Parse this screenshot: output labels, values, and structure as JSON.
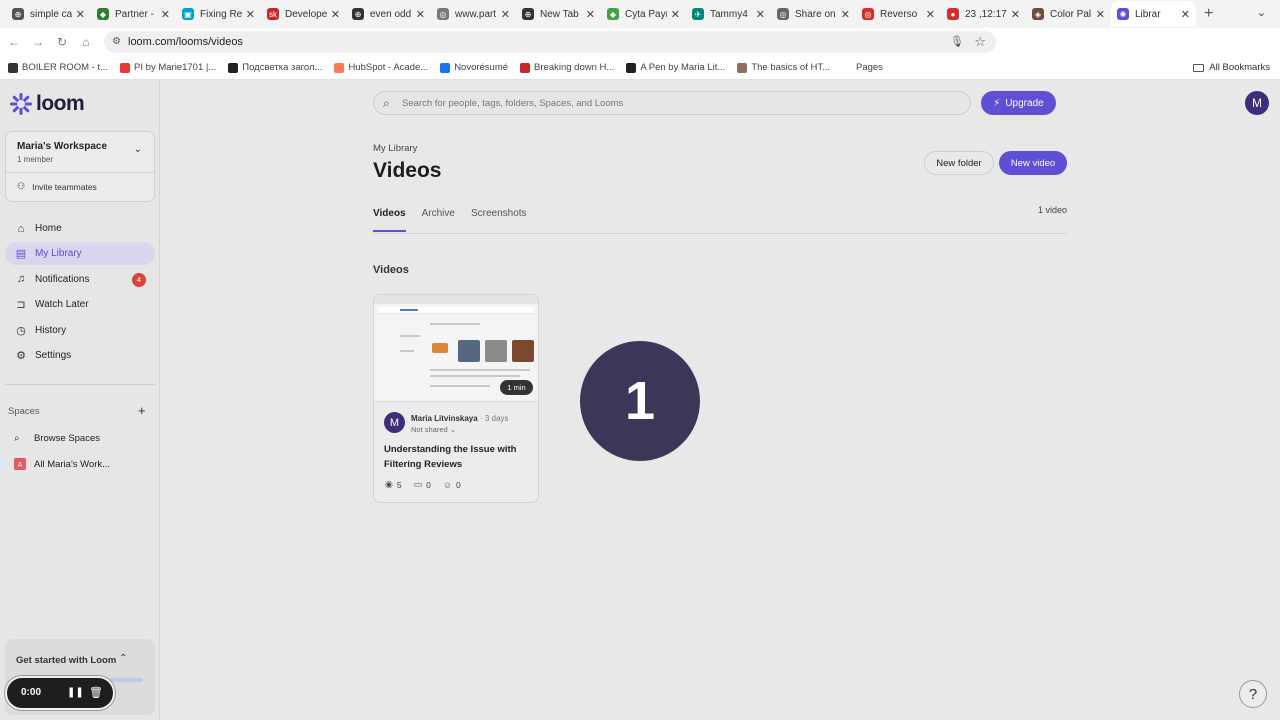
{
  "browser": {
    "tabs": [
      {
        "title": "simple ca",
        "color": "#555555",
        "glyph": "⊕"
      },
      {
        "title": "Partner -",
        "color": "#2e7d32",
        "glyph": "◆"
      },
      {
        "title": "Fixing Re",
        "color": "#00a3c4",
        "glyph": "▣"
      },
      {
        "title": "Develope",
        "color": "#c62828",
        "glyph": "sk"
      },
      {
        "title": "even odd",
        "color": "#333333",
        "glyph": "⊕"
      },
      {
        "title": "www.part",
        "color": "#777777",
        "glyph": "◎"
      },
      {
        "title": "New Tab",
        "color": "#333333",
        "glyph": "⊕"
      },
      {
        "title": "Cyta Payr",
        "color": "#43a047",
        "glyph": "◆"
      },
      {
        "title": "Tammy4",
        "color": "#00897b",
        "glyph": "✈"
      },
      {
        "title": "Share on",
        "color": "#666666",
        "glyph": "◎"
      },
      {
        "title": "Reverso",
        "color": "#d32f2f",
        "glyph": "◎"
      },
      {
        "title": "23 ,12:17]",
        "color": "#d32f2f",
        "glyph": "●"
      },
      {
        "title": "Color Pal",
        "color": "#6d4c41",
        "glyph": "◈"
      },
      {
        "title": "Librar",
        "color": "#5e4fd4",
        "glyph": "✺",
        "active": true
      }
    ],
    "new_tab": "+",
    "url": "loom.com/looms/videos",
    "bookmarks": [
      {
        "label": "BOILER ROOM - t...",
        "color": "#333333"
      },
      {
        "label": "PI by Marie1701 |...",
        "color": "#e53935"
      },
      {
        "label": "Подсветка загол...",
        "color": "#222222"
      },
      {
        "label": "HubSpot - Acade...",
        "color": "#ff7a59"
      },
      {
        "label": "Novorésumé",
        "color": "#1a73e8"
      },
      {
        "label": "Breaking down H...",
        "color": "#c62828"
      },
      {
        "label": "A Pen by Maria Lit...",
        "color": "#222222"
      },
      {
        "label": "The basics of HT...",
        "color": "#8d6e63"
      },
      {
        "label": "Pages",
        "color": "#ffffff"
      }
    ],
    "all_bookmarks": "All Bookmarks"
  },
  "sidebar": {
    "logo": "loom",
    "workspace": {
      "name": "Maria's Workspace",
      "members": "1 member",
      "invite": "Invite teammates"
    },
    "nav": [
      {
        "label": "Home",
        "icon": "home-icon",
        "glyph": "⌂"
      },
      {
        "label": "My Library",
        "icon": "library-icon",
        "glyph": "▤",
        "active": true
      },
      {
        "label": "Notifications",
        "icon": "bell-icon",
        "glyph": "♫",
        "badge": "4"
      },
      {
        "label": "Watch Later",
        "icon": "bookmark-icon",
        "glyph": "⊐"
      },
      {
        "label": "History",
        "icon": "clock-icon",
        "glyph": "◷"
      },
      {
        "label": "Settings",
        "icon": "gear-icon",
        "glyph": "⚙"
      }
    ],
    "spaces_heading": "Spaces",
    "browse_spaces": "Browse Spaces",
    "all_workspace": "All Maria's Work...",
    "all_workspace_initial": "A",
    "get_started": "Get started with Loom",
    "recorder": {
      "time": "0:00"
    }
  },
  "header": {
    "search_placeholder": "Search for people, tags, folders, Spaces, and Looms",
    "upgrade": "Upgrade",
    "user_initial": "M"
  },
  "main": {
    "breadcrumb": "My Library",
    "title": "Videos",
    "new_folder": "New folder",
    "new_video": "New video",
    "tabs": [
      {
        "label": "Videos",
        "active": true
      },
      {
        "label": "Archive"
      },
      {
        "label": "Screenshots"
      }
    ],
    "count": "1 video",
    "section_title": "Videos",
    "video": {
      "duration": "1 min",
      "author": "Maria Litvinskaya",
      "age": "3 days",
      "sharing": "Not shared",
      "title": "Understanding the Issue with Filtering Reviews",
      "views": "5",
      "comments": "0",
      "reactions": "0",
      "author_initial": "M"
    },
    "overlay_number": "1"
  },
  "help": "?",
  "colors": {
    "accent": "#5e4fd4",
    "badge": "#d8453a",
    "overlay": "#3a3758"
  }
}
